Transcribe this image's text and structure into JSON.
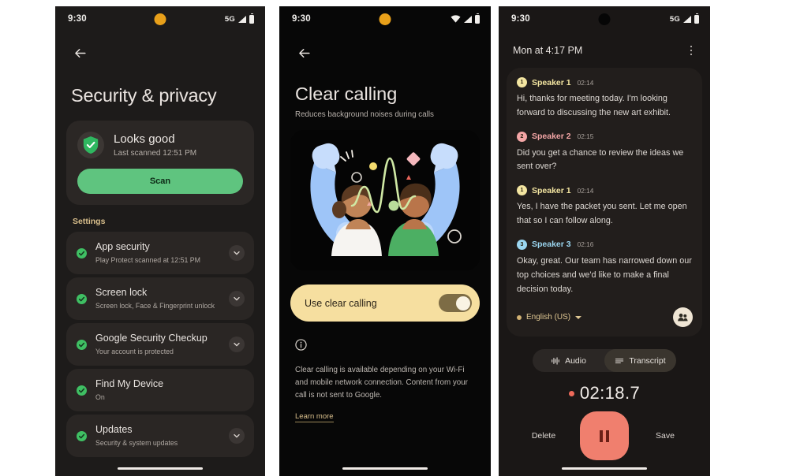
{
  "panel1": {
    "status": {
      "time": "9:30",
      "network": "5G",
      "icons": [
        "signal-icon",
        "battery-icon"
      ],
      "camera": "orange-punch-hole"
    },
    "back_icon": "arrow-back-icon",
    "title": "Security & privacy",
    "status_card": {
      "shield_icon": "shield-check-icon",
      "headline": "Looks good",
      "subtext": "Last scanned 12:51 PM",
      "scan_button": "Scan",
      "accent": "#5fc47f"
    },
    "section_label": "Settings",
    "section_label_color": "#d9bf8c",
    "items": [
      {
        "title": "App security",
        "subtitle": "Play Protect scanned at 12:51 PM",
        "status_icon": "check-circle-icon",
        "chevron": "chevron-down-icon"
      },
      {
        "title": "Screen lock",
        "subtitle": "Screen lock, Face & Fingerprint unlock",
        "status_icon": "check-circle-icon",
        "chevron": "chevron-down-icon"
      },
      {
        "title": "Google Security Checkup",
        "subtitle": "Your account is protected",
        "status_icon": "check-circle-icon",
        "chevron": "chevron-down-icon"
      },
      {
        "title": "Find My Device",
        "subtitle": "On",
        "status_icon": "check-circle-icon",
        "chevron": ""
      },
      {
        "title": "Updates",
        "subtitle": "Security & system updates",
        "status_icon": "check-circle-icon",
        "chevron": "chevron-down-icon"
      }
    ]
  },
  "panel2": {
    "status": {
      "time": "9:30",
      "network": "",
      "icons": [
        "wifi-icon",
        "signal-icon",
        "battery-icon"
      ],
      "camera": "orange-punch-hole"
    },
    "back_icon": "arrow-back-icon",
    "title": "Clear calling",
    "subtitle": "Reduces background noises during calls",
    "illustration": "two-people-in-phone-handsets-with-waveform",
    "toggle": {
      "label": "Use clear calling",
      "state": "on",
      "card_color": "#f6dfa0"
    },
    "info_icon": "info-circle-icon",
    "body": "Clear calling is available depending on your Wi-Fi and mobile network connection. Content from your call is not sent to Google.",
    "learn_more": "Learn more"
  },
  "panel3": {
    "status": {
      "time": "9:30",
      "network": "5G",
      "icons": [
        "signal-icon",
        "battery-icon"
      ],
      "camera": "black-punch-hole"
    },
    "header": {
      "datetime": "Mon at 4:17 PM",
      "menu_icon": "more-vert-icon"
    },
    "turns": [
      {
        "badge": "1",
        "badge_color": "#f3e5a1",
        "name": "Speaker 1",
        "name_color": "#f3e5a1",
        "time": "02:14",
        "text": "Hi, thanks for meeting today. I'm looking forward to discussing the new art exhibit."
      },
      {
        "badge": "2",
        "badge_color": "#f4a6a6",
        "name": "Speaker 2",
        "name_color": "#f4a6a6",
        "time": "02:15",
        "text": "Did you get a chance to review the ideas we sent over?"
      },
      {
        "badge": "1",
        "badge_color": "#f3e5a1",
        "name": "Speaker 1",
        "name_color": "#f3e5a1",
        "time": "02:14",
        "text": "Yes, I have the packet you sent. Let me open that so I can follow along."
      },
      {
        "badge": "3",
        "badge_color": "#9bd6f0",
        "name": "Speaker 3",
        "name_color": "#9bd6f0",
        "time": "02:16",
        "text": "Okay, great. Our team has narrowed down our top choices and we'd like to make a final decision today."
      }
    ],
    "language": {
      "label": "English (US)",
      "dropdown_icon": "caret-down-icon",
      "dot_color": "#d2b273"
    },
    "speakers_button_icon": "people-icon",
    "segments": [
      {
        "label": "Audio",
        "icon": "waveform-icon",
        "active": false
      },
      {
        "label": "Transcript",
        "icon": "lines-icon",
        "active": true
      }
    ],
    "recording": {
      "dot_color": "#ee6a5a",
      "elapsed": "02:18.7"
    },
    "controls": {
      "delete_label": "Delete",
      "save_label": "Save",
      "record_button_icon": "pause-icon",
      "record_button_color": "#f07f6e"
    }
  }
}
